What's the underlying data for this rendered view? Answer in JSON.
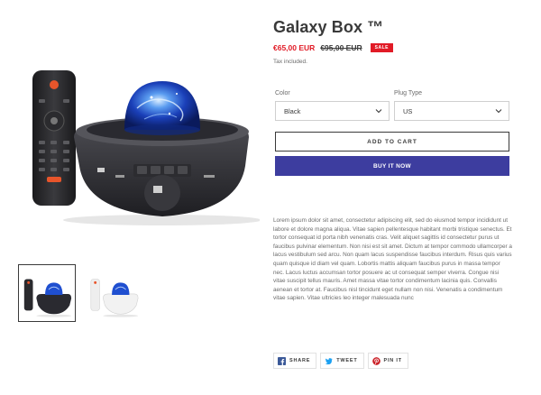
{
  "product": {
    "title": "Galaxy Box ™",
    "price_sale": "€65,00 EUR",
    "price_regular": "€95,00 EUR",
    "sale_badge": "SALE",
    "tax_note": "Tax included."
  },
  "options": {
    "color_label": "Color",
    "color_value": "Black",
    "plug_label": "Plug Type",
    "plug_value": "US"
  },
  "buttons": {
    "add_to_cart": "ADD TO CART",
    "buy_now": "BUY IT NOW"
  },
  "description": "Lorem ipsum dolor sit amet, consectetur adipiscing elit, sed do eiusmod tempor incididunt ut labore et dolore magna aliqua. Vitae sapien pellentesque habitant morbi tristique senectus. Et tortor consequat id porta nibh venenatis cras. Velit aliquet sagittis id consectetur purus ut faucibus pulvinar elementum. Non nisi est sit amet. Dictum at tempor commodo ullamcorper a lacus vestibulum sed arcu. Non quam lacus suspendisse faucibus interdum. Risus quis varius quam quisque id diam vel quam. Lobortis mattis aliquam faucibus purus in massa tempor nec. Lacus luctus accumsan tortor posuere ac ut consequat semper viverra. Congue nisi vitae suscipit tellus mauris. Amet massa vitae tortor condimentum lacinia quis. Convallis aenean et tortor at. Faucibus nisl tincidunt eget nullam non nisi. Venenatis a condimentum vitae sapien. Vitae ultricies leo integer malesuada nunc",
  "share": {
    "share_label": "SHARE",
    "tweet_label": "TWEET",
    "pin_label": "PIN IT"
  },
  "icons": {
    "facebook": "facebook-icon",
    "twitter": "twitter-icon",
    "pinterest": "pinterest-icon",
    "chevron": "chevron-down-icon"
  },
  "colors": {
    "sale_red": "#e11b26",
    "buy_button": "#3d3d9f",
    "text": "#3a3a3a",
    "muted": "#6b6b6b",
    "facebook": "#3b5998",
    "twitter": "#1da1f2",
    "pinterest": "#cb2027"
  }
}
